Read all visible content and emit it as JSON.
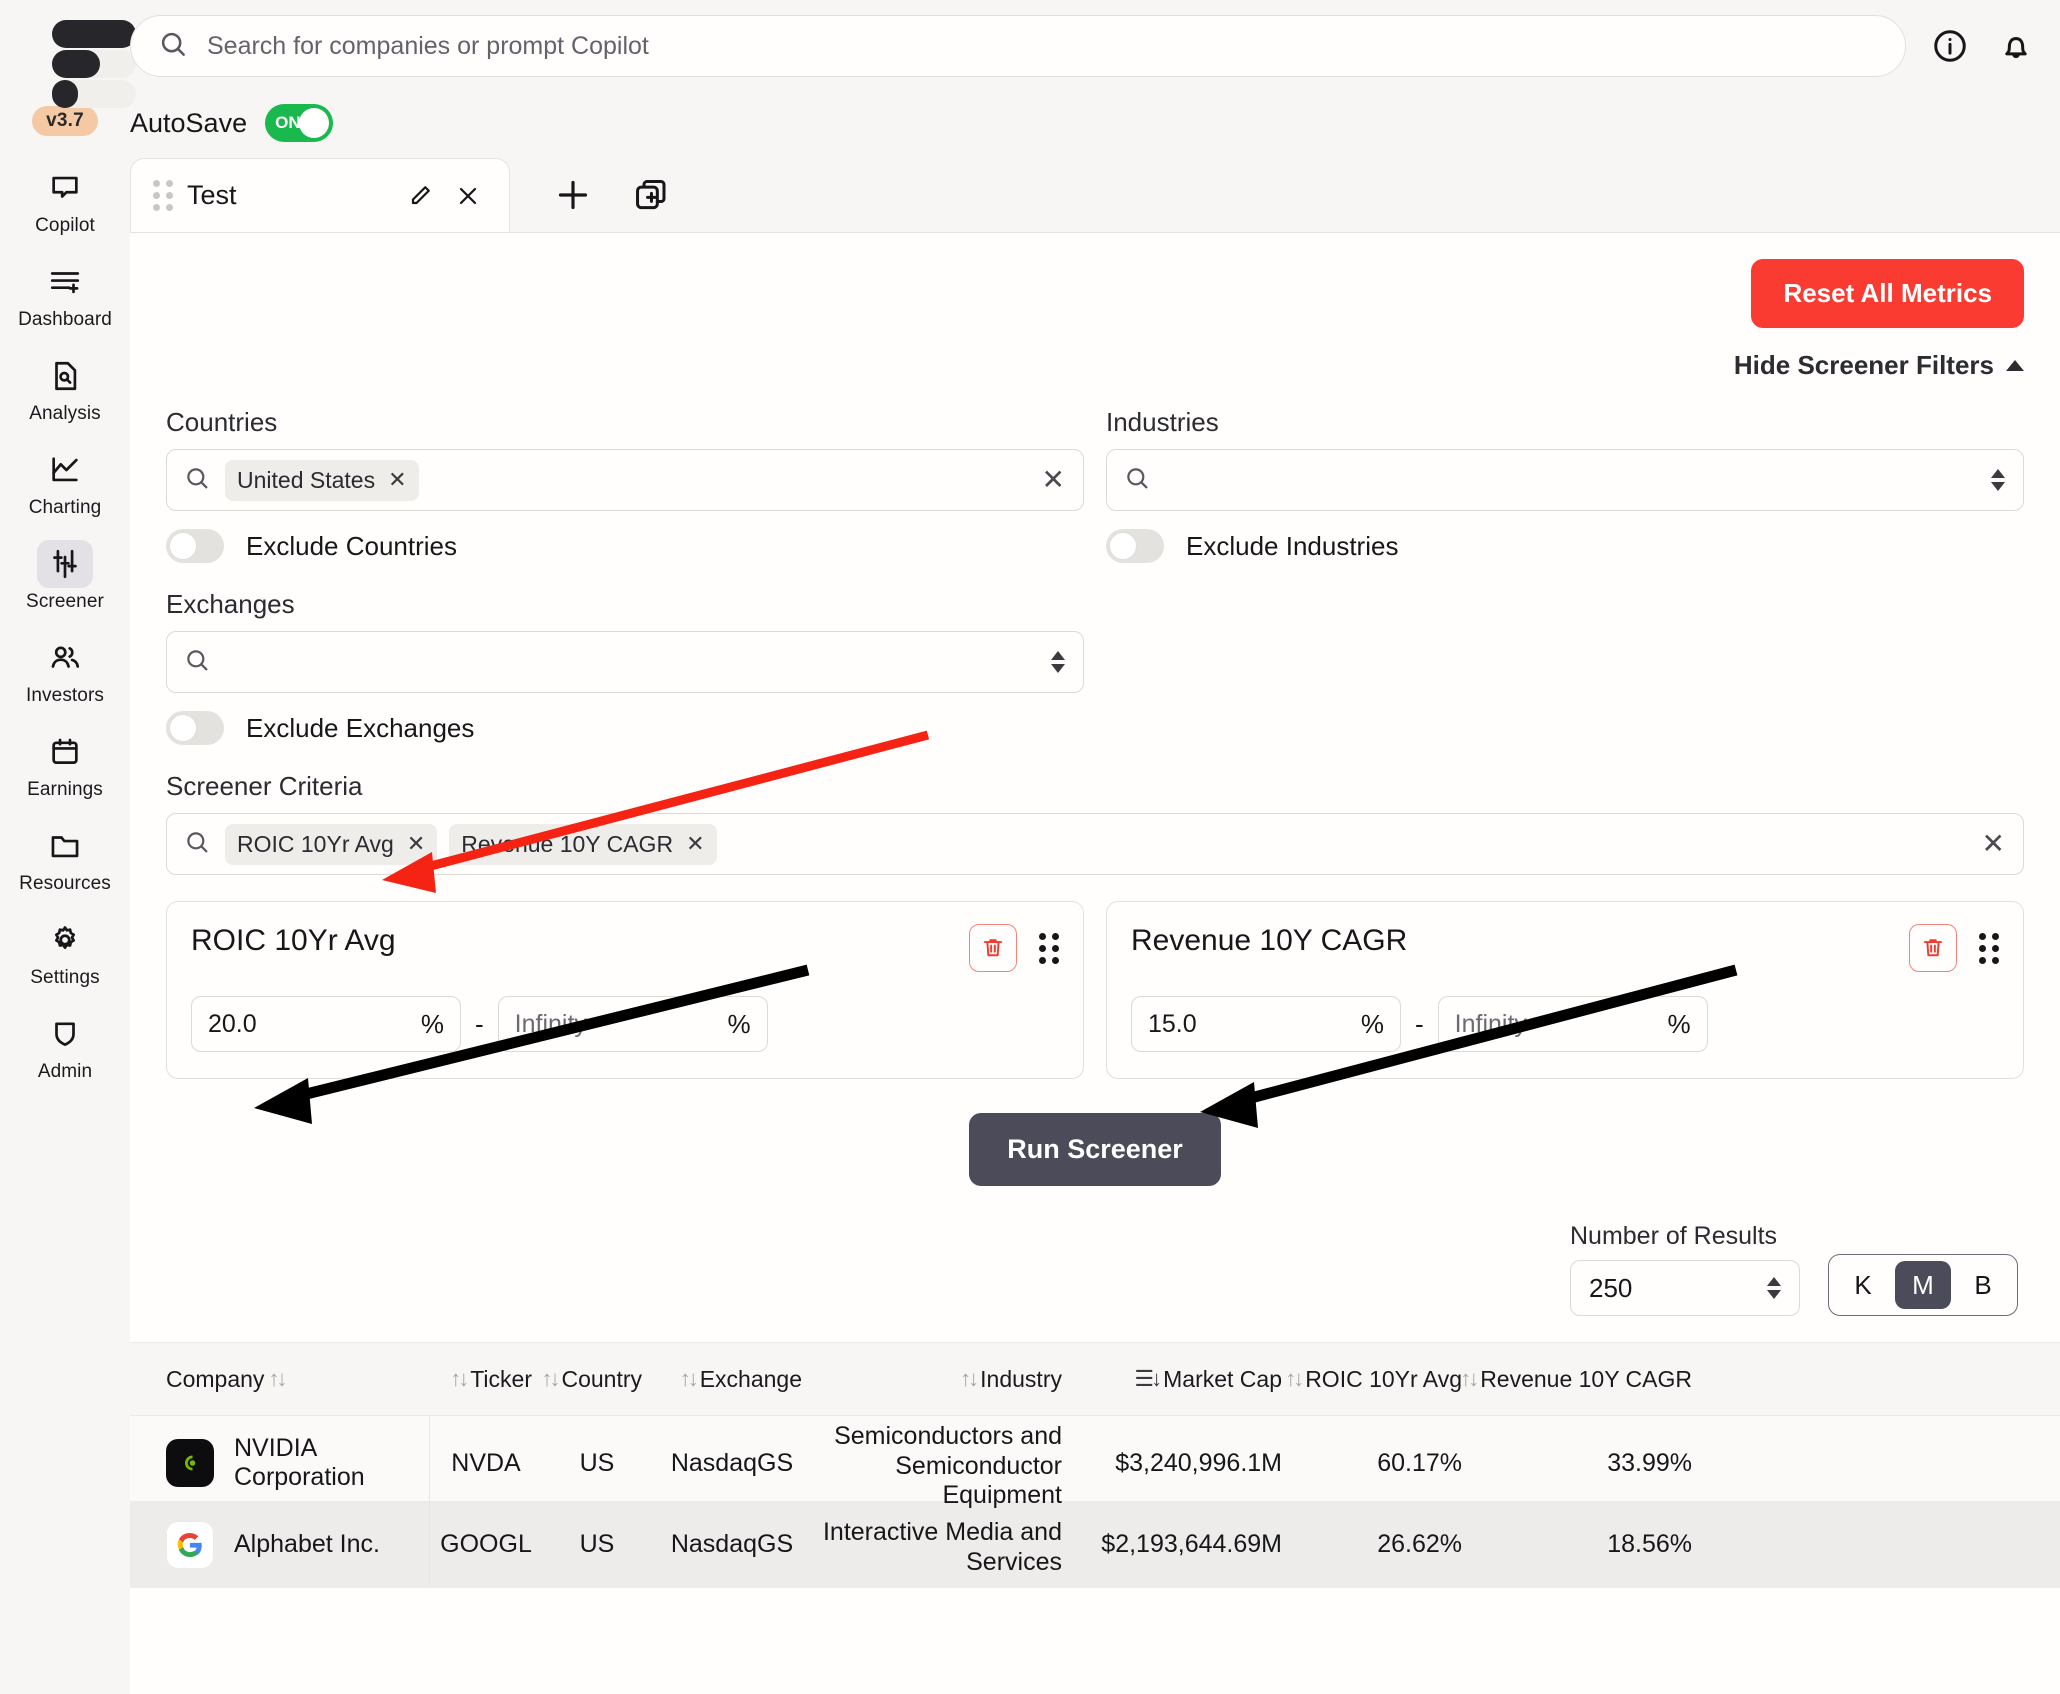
{
  "brand": {
    "version_badge": "v3.7",
    "logo_name": "finance-app-logo"
  },
  "search": {
    "placeholder": "Search for companies or prompt Copilot"
  },
  "header": {
    "info_icon": "info-circle-icon",
    "bell_icon": "notification-bell-icon",
    "autosave_label": "AutoSave",
    "autosave_state": "ON"
  },
  "sidebar": {
    "items": [
      {
        "label": "Copilot",
        "icon": "chat-bubble-icon",
        "active": false
      },
      {
        "label": "Dashboard",
        "icon": "dashboard-add-icon",
        "active": false
      },
      {
        "label": "Analysis",
        "icon": "document-search-icon",
        "active": false
      },
      {
        "label": "Charting",
        "icon": "line-chart-icon",
        "active": false
      },
      {
        "label": "Screener",
        "icon": "sliders-icon",
        "active": true
      },
      {
        "label": "Investors",
        "icon": "people-icon",
        "active": false
      },
      {
        "label": "Earnings",
        "icon": "calendar-icon",
        "active": false
      },
      {
        "label": "Resources",
        "icon": "folder-icon",
        "active": false
      },
      {
        "label": "Settings",
        "icon": "gear-icon",
        "active": false
      },
      {
        "label": "Admin",
        "icon": "shield-icon",
        "active": false
      }
    ]
  },
  "tabs": {
    "active_tab": "Test",
    "edit_icon": "pencil-icon",
    "close_icon": "close-icon",
    "add_tab_icon": "plus-icon",
    "duplicate_tab_icon": "duplicate-tab-icon"
  },
  "toolbar": {
    "reset_label": "Reset All Metrics",
    "reset_color": "#f93b32",
    "hide_filters_label": "Hide Screener Filters"
  },
  "filters": {
    "countries": {
      "label": "Countries",
      "chips": [
        "United States"
      ],
      "exclude_label": "Exclude Countries",
      "exclude_on": false
    },
    "industries": {
      "label": "Industries",
      "chips": [],
      "exclude_label": "Exclude Industries",
      "exclude_on": false
    },
    "exchanges": {
      "label": "Exchanges",
      "chips": [],
      "exclude_label": "Exclude Exchanges",
      "exclude_on": false
    },
    "criteria": {
      "label": "Screener Criteria",
      "chips": [
        "ROIC 10Yr Avg",
        "Revenue 10Y CAGR"
      ]
    }
  },
  "metric_cards": [
    {
      "title": "ROIC 10Yr Avg",
      "min_value": "20.0",
      "max_placeholder": "Infinity",
      "unit": "%",
      "separator": "-"
    },
    {
      "title": "Revenue 10Y CAGR",
      "min_value": "15.0",
      "max_placeholder": "Infinity",
      "unit": "%",
      "separator": "-"
    }
  ],
  "run": {
    "label": "Run Screener",
    "color": "#4b4b59"
  },
  "results_controls": {
    "number_label": "Number of Results",
    "number_value": "250",
    "unit_options": [
      "K",
      "M",
      "B"
    ],
    "unit_selected": "M"
  },
  "table": {
    "columns": [
      {
        "label": "Company",
        "sort": "both",
        "align": "left"
      },
      {
        "label": "Ticker",
        "sort": "both",
        "align": "center"
      },
      {
        "label": "Country",
        "sort": "both",
        "align": "center"
      },
      {
        "label": "Exchange",
        "sort": "both",
        "align": "center"
      },
      {
        "label": "Industry",
        "sort": "both",
        "align": "right"
      },
      {
        "label": "Market Cap",
        "sort": "desc",
        "align": "right"
      },
      {
        "label": "ROIC 10Yr Avg",
        "sort": "both",
        "align": "right"
      },
      {
        "label": "Revenue 10Y CAGR",
        "sort": "both",
        "align": "right"
      }
    ],
    "rows": [
      {
        "logo": "nvidia-logo",
        "company": "NVIDIA Corporation",
        "ticker": "NVDA",
        "country": "US",
        "exchange": "NasdaqGS",
        "industry": "Semiconductors and Semiconductor Equipment",
        "market_cap": "$3,240,996.1M",
        "roic": "60.17%",
        "revenue_cagr": "33.99%"
      },
      {
        "logo": "google-logo",
        "company": "Alphabet Inc.",
        "ticker": "GOOGL",
        "country": "US",
        "exchange": "NasdaqGS",
        "industry": "Interactive Media and Services",
        "market_cap": "$2,193,644.69M",
        "roic": "26.62%",
        "revenue_cagr": "18.56%"
      }
    ]
  },
  "annotations": {
    "red_arrow": "arrow-pointing-to-screener-criteria",
    "black_arrow_left": "arrow-pointing-to-roic-min-input",
    "black_arrow_right": "arrow-pointing-to-revenue-cagr-min-input",
    "red_color": "#f42314",
    "black_color": "#000000"
  }
}
